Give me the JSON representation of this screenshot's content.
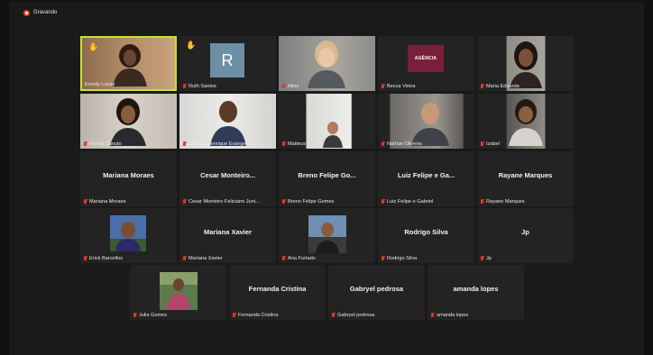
{
  "recording": {
    "label": "Gravando"
  },
  "tiles": [
    {
      "name": "Kemily Lucas"
    },
    {
      "name": "Ruth Santos",
      "avatar_letter": "R"
    },
    {
      "name": "Aline"
    },
    {
      "name": "Becca Vieira",
      "logo": "AGÊNCIA"
    },
    {
      "name": "Maria Eduarda"
    },
    {
      "name": "Perola Canuto"
    },
    {
      "name": "Glaucio Henrique Evangelista ..."
    },
    {
      "name": "Matteus"
    },
    {
      "name": "Nathan Oliveira"
    },
    {
      "name": "Izabel"
    },
    {
      "name": "Mariana Moraes",
      "display": "Mariana Moraes"
    },
    {
      "name": "Cesar Monteiro Feliciano Juni...",
      "display": "Cesar  Monteiro..."
    },
    {
      "name": "Breno Felipe Gomes",
      "display": "Breno  Felipe Go..."
    },
    {
      "name": "Luiz Felipe e Gabriel",
      "display": "Luiz Felipe e Ga..."
    },
    {
      "name": "Rayane Marques",
      "display": "Rayane Marques"
    },
    {
      "name": "Erick Barcellos"
    },
    {
      "name": "Mariana Xavier",
      "display": "Mariana Xavier"
    },
    {
      "name": "Ana Furtado"
    },
    {
      "name": "Rodrigo Silva",
      "display": "Rodrigo Silva"
    },
    {
      "name": "Jp",
      "display": "Jp"
    },
    {
      "name": "Julia Gomes"
    },
    {
      "name": "Fernanda Cristina",
      "display": "Fernanda Cristina"
    },
    {
      "name": "Gabryel pedrosa",
      "display": "Gabryel pedrosa"
    },
    {
      "name": "amanda lopes",
      "display": "amanda lopes"
    }
  ],
  "colors": {
    "active_speaker": "#c7df3a",
    "mic_muted": "#e0382b",
    "hand": "#f3b61f",
    "recording": "#e2411f"
  }
}
